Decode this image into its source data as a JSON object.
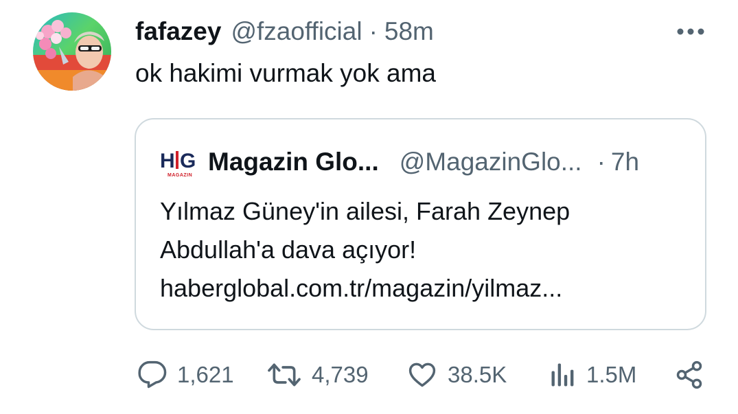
{
  "tweet": {
    "display_name": "fafazey",
    "handle": "@fzaofficial",
    "separator": "·",
    "time": "58m",
    "text": "ok hakimi vurmak yok ama"
  },
  "quoted": {
    "logo_text": "H|G",
    "logo_sub": "MAGAZIN",
    "display_name": "Magazin Glo...",
    "handle": "@MagazinGlo...",
    "separator": "·",
    "time": "7h",
    "text_lines": [
      "Yılmaz Güney'in ailesi, Farah Zeynep",
      "Abdullah'a dava açıyor!",
      "haberglobal.com.tr/magazin/yilmaz..."
    ]
  },
  "actions": {
    "replies": "1,621",
    "retweets": "4,739",
    "likes": "38.5K",
    "views": "1.5M"
  },
  "icons": {
    "more": "more-icon",
    "reply": "reply-icon",
    "retweet": "retweet-icon",
    "like": "heart-icon",
    "views": "views-icon",
    "share": "share-icon"
  },
  "colors": {
    "text": "#0f1419",
    "secondary": "#536471",
    "border": "#cfd9de",
    "logo_red": "#d0202a",
    "logo_navy": "#1a2a5a"
  }
}
